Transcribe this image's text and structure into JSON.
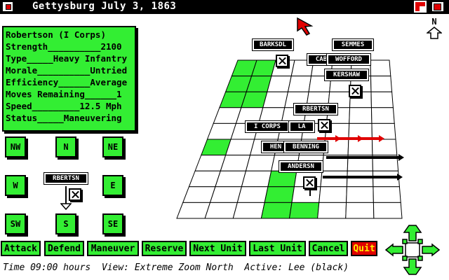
{
  "window": {
    "title": "Gettysburg July 3, 1863"
  },
  "unit_info": {
    "lines": [
      "Robertson (I Corps)",
      "Strength__________2100",
      "Type_____Heavy Infantry",
      "Morale__________Untried",
      "Efficiency______Average",
      "Moves Remaining______1",
      "Speed_________12.5 Mph",
      "Status_____Maneuvering"
    ]
  },
  "direction_pad": {
    "nw": "NW",
    "n": "N",
    "ne": "NE",
    "w": "W",
    "e": "E",
    "sw": "SW",
    "s": "S",
    "se": "SE",
    "center_unit": "RBERTSN"
  },
  "commands": {
    "attack": "Attack",
    "defend": "Defend",
    "maneuver": "Maneuver",
    "reserve": "Reserve",
    "next_unit": "Next Unit",
    "last_unit": "Last Unit",
    "cancel": "Cancel",
    "quit": "Quit"
  },
  "status_bar": {
    "text": "Time 09:00 hours  View: Extreme Zoom North  Active: Lee (black)"
  },
  "compass": {
    "label": "N"
  },
  "units": [
    {
      "name": "BARKSDL"
    },
    {
      "name": "SEMMES"
    },
    {
      "name": "CAB"
    },
    {
      "name": "WOFFORD"
    },
    {
      "name": "KERSHAW"
    },
    {
      "name": "RBERTSN"
    },
    {
      "name": "I CORPS"
    },
    {
      "name": "LA"
    },
    {
      "name": "HEN"
    },
    {
      "name": "BENNING"
    },
    {
      "name": "ANDERSN"
    }
  ],
  "colors": {
    "panel_green": "#33ee33",
    "terrain_green": "#33ee33",
    "enemy_arrow_red": "#e00000",
    "title_bar": "#000000",
    "quit_button": "#e00000"
  }
}
